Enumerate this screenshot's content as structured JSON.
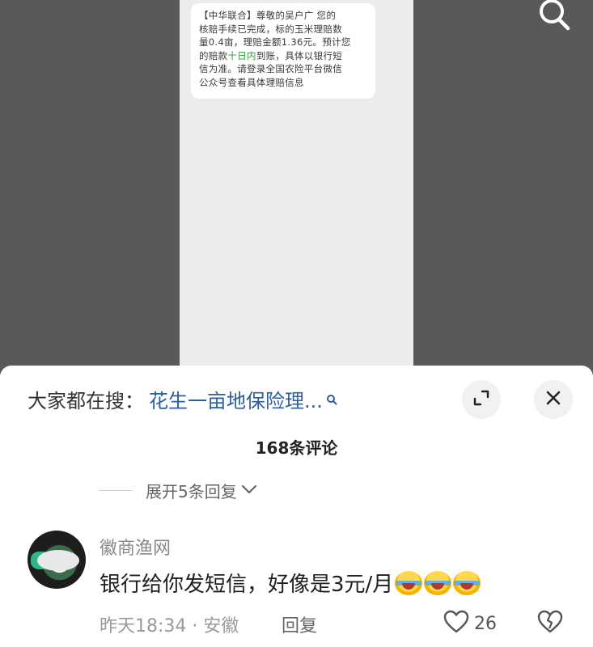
{
  "sms": {
    "line1": "【中华联合】尊敬的吴户广   您的",
    "line2": "核赔手续已完成，标的玉米理赔数",
    "line3": "量0.4亩，理赔金额1.36元。预计您",
    "line4_pre": "的赔款",
    "line4_green": "十日内",
    "line4_post": "到账，具体以银行短",
    "line5": "信为准。请登录全国农险平台微信",
    "line6": "公众号查看具体理赔信息"
  },
  "search": {
    "prefix": "大家都在搜：",
    "term": "花生一亩地保险理..."
  },
  "comments": {
    "count_label": "168条评论",
    "expand_label": "展开5条回复"
  },
  "comment": {
    "username": "徽商渔网",
    "text": "银行给你发短信，好像是3元/月",
    "time_location": "昨天18:34 · 安徽",
    "reply_label": "回复",
    "like_count": "26"
  },
  "icons": {
    "top_search": "search-icon",
    "expand": "expand-icon",
    "close": "close-icon",
    "like": "heart-icon",
    "dislike": "broken-heart-icon",
    "emoji": "laugh-cry-emoji"
  },
  "colors": {
    "search_term": "#2c5d9c",
    "sms_highlight": "#2e9e3e"
  }
}
